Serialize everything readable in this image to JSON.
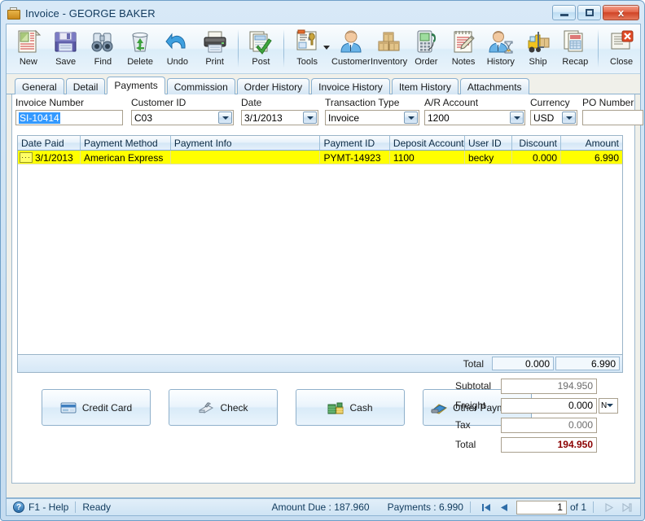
{
  "window": {
    "title": "Invoice - GEORGE BAKER",
    "minimize_label": "Minimize",
    "maximize_label": "Maximize",
    "close_label": "x"
  },
  "toolbar": {
    "items": [
      {
        "label": "New",
        "icon": "new-document-icon"
      },
      {
        "label": "Save",
        "icon": "floppy-disk-icon"
      },
      {
        "label": "Find",
        "icon": "binoculars-icon"
      },
      {
        "label": "Delete",
        "icon": "recycle-bin-icon"
      },
      {
        "label": "Undo",
        "icon": "undo-arrow-icon"
      },
      {
        "label": "Print",
        "icon": "printer-icon"
      },
      {
        "label": "Post",
        "icon": "post-checkmark-icon"
      },
      {
        "label": "Tools",
        "icon": "tools-icon"
      },
      {
        "label": "Customer",
        "icon": "customer-person-icon"
      },
      {
        "label": "Inventory",
        "icon": "boxes-icon"
      },
      {
        "label": "Order",
        "icon": "order-phone-icon"
      },
      {
        "label": "Notes",
        "icon": "notepad-pencil-icon"
      },
      {
        "label": "History",
        "icon": "history-person-hourglass-icon"
      },
      {
        "label": "Ship",
        "icon": "forklift-icon"
      },
      {
        "label": "Recap",
        "icon": "recap-documents-icon"
      },
      {
        "label": "Close",
        "icon": "close-document-icon"
      }
    ]
  },
  "tabs": [
    {
      "label": "General",
      "active": false
    },
    {
      "label": "Detail",
      "active": false
    },
    {
      "label": "Payments",
      "active": true
    },
    {
      "label": "Commission",
      "active": false
    },
    {
      "label": "Order History",
      "active": false
    },
    {
      "label": "Invoice History",
      "active": false
    },
    {
      "label": "Item History",
      "active": false
    },
    {
      "label": "Attachments",
      "active": false
    }
  ],
  "fields": {
    "invoice_number": {
      "label": "Invoice Number",
      "value": "SI-10414",
      "selected": true
    },
    "customer_id": {
      "label": "Customer ID",
      "value": "C03"
    },
    "date": {
      "label": "Date",
      "value": "3/1/2013"
    },
    "transaction_type": {
      "label": "Transaction Type",
      "value": "Invoice"
    },
    "ar_account": {
      "label": "A/R Account",
      "value": "1200"
    },
    "currency": {
      "label": "Currency",
      "value": "USD"
    },
    "po_number": {
      "label": "PO Number",
      "value": ""
    }
  },
  "grid": {
    "columns": [
      {
        "key": "date_paid",
        "label": "Date Paid",
        "align": "left"
      },
      {
        "key": "payment_method",
        "label": "Payment Method",
        "align": "left"
      },
      {
        "key": "payment_info",
        "label": "Payment Info",
        "align": "left"
      },
      {
        "key": "payment_id",
        "label": "Payment ID",
        "align": "left"
      },
      {
        "key": "deposit_account",
        "label": "Deposit Account",
        "align": "left"
      },
      {
        "key": "user_id",
        "label": "User ID",
        "align": "left"
      },
      {
        "key": "discount",
        "label": "Discount",
        "align": "right"
      },
      {
        "key": "amount",
        "label": "Amount",
        "align": "right"
      }
    ],
    "rows": [
      {
        "date_paid": "3/1/2013",
        "payment_method": "American Express",
        "payment_info": "",
        "payment_id": "PYMT-14923",
        "deposit_account": "1100",
        "user_id": "becky",
        "discount": "0.000",
        "amount": "6.990",
        "selected": true,
        "ellipsis": "···"
      }
    ],
    "footer": {
      "total_label": "Total",
      "total_discount": "0.000",
      "total_amount": "6.990"
    }
  },
  "payment_buttons": [
    {
      "label": "Credit Card",
      "icon": "credit-card-icon"
    },
    {
      "label": "Check",
      "icon": "check-icon"
    },
    {
      "label": "Cash",
      "icon": "cash-icon"
    },
    {
      "label": "Other Payments",
      "icon": "other-payments-icon"
    }
  ],
  "summary": {
    "subtotal": {
      "label": "Subtotal",
      "value": "194.950"
    },
    "freight": {
      "label": "Freight",
      "value": "0.000",
      "taxable_code": "N"
    },
    "tax": {
      "label": "Tax",
      "value": "0.000"
    },
    "total": {
      "label": "Total",
      "value": "194.950"
    }
  },
  "statusbar": {
    "help": "F1 - Help",
    "state": "Ready",
    "amount_due": "Amount Due : 187.960",
    "payments": "Payments : 6.990",
    "page_value": "1",
    "of_label": "of 1"
  },
  "colors": {
    "selection_row": "#ffff00",
    "text_selection": "#3399ff",
    "total_accent": "#8b0000",
    "window_border": "#6f9fc8"
  }
}
